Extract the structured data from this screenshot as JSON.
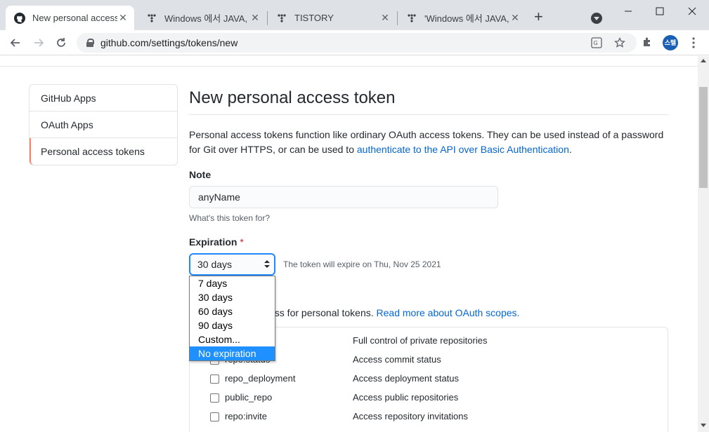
{
  "browser": {
    "tabs": [
      {
        "title": "New personal access t",
        "favicon": "github-icon",
        "active": true
      },
      {
        "title": "Windows 에서 JAVA, M",
        "favicon": "tistory-icon"
      },
      {
        "title": "TISTORY",
        "favicon": "tistory-icon"
      },
      {
        "title": "'Windows 에서 JAVA, l",
        "favicon": "tistory-icon"
      }
    ],
    "tab_close": "✕",
    "new_tab": "+",
    "url": "github.com/settings/tokens/new",
    "avatar_text": "스텔"
  },
  "sidebar": {
    "items": [
      {
        "label": "GitHub Apps"
      },
      {
        "label": "OAuth Apps"
      },
      {
        "label": "Personal access tokens",
        "selected": true
      }
    ]
  },
  "main": {
    "title": "New personal access token",
    "description_prefix": "Personal access tokens function like ordinary OAuth access tokens. They can be used instead of a password for Git over HTTPS, or can be used to ",
    "description_link": "authenticate to the API over Basic Authentication",
    "description_suffix": ".",
    "note_label": "Note",
    "note_value": "anyName",
    "note_hint": "What's this token for?",
    "expiration_label": "Expiration",
    "required_mark": "*",
    "expiration_selected": "30 days",
    "expiration_note": "The token will expire on Thu, Nov 25 2021",
    "expiration_options": [
      "7 days",
      "30 days",
      "60 days",
      "90 days",
      "Custom...",
      "No expiration"
    ],
    "highlighted_option": "No expiration",
    "scopes_text": "ccess for personal tokens. ",
    "scopes_link": "Read more about OAuth scopes.",
    "scopes": [
      {
        "name": "",
        "desc": "Full control of private repositories"
      },
      {
        "name": "repo:status",
        "desc": "Access commit status"
      },
      {
        "name": "repo_deployment",
        "desc": "Access deployment status"
      },
      {
        "name": "public_repo",
        "desc": "Access public repositories"
      },
      {
        "name": "repo:invite",
        "desc": "Access repository invitations"
      }
    ]
  },
  "colors": {
    "link": "#0366d6",
    "selected_border": "#f9826c",
    "focus_ring": "#2188ff",
    "dropdown_highlight": "#1e90ff"
  }
}
